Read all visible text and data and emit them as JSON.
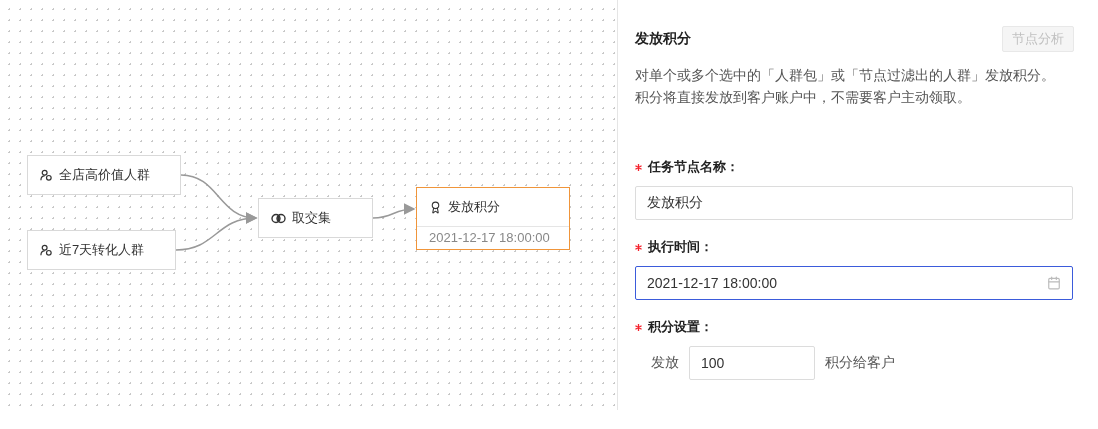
{
  "canvas": {
    "nodes": [
      {
        "kind": "audience",
        "label": "全店高价值人群",
        "selected": false
      },
      {
        "kind": "audience",
        "label": "近7天转化人群",
        "selected": false
      },
      {
        "kind": "intersect",
        "label": "取交集",
        "selected": false
      },
      {
        "kind": "task",
        "label": "发放积分",
        "time": "2021-12-17 18:00:00",
        "selected": true
      }
    ]
  },
  "panel": {
    "title": "发放积分",
    "analysis_button": {
      "label": "节点分析",
      "disabled": true
    },
    "description": "对单个或多个选中的「人群包」或「节点过滤出的人群」发放积分。积分将直接发放到客户账户中，不需要客户主动领取。",
    "fields": [
      {
        "kind": "text",
        "label": "任务节点名称：",
        "required": true,
        "value": "发放积分",
        "focused": false
      },
      {
        "kind": "date",
        "label": "执行时间：",
        "required": true,
        "value": "2021-12-17 18:00:00",
        "focused": true
      },
      {
        "kind": "points",
        "label": "积分设置：",
        "required": true,
        "prefix": "发放",
        "value": "100",
        "suffix": "积分给客户",
        "focused": false
      }
    ]
  }
}
